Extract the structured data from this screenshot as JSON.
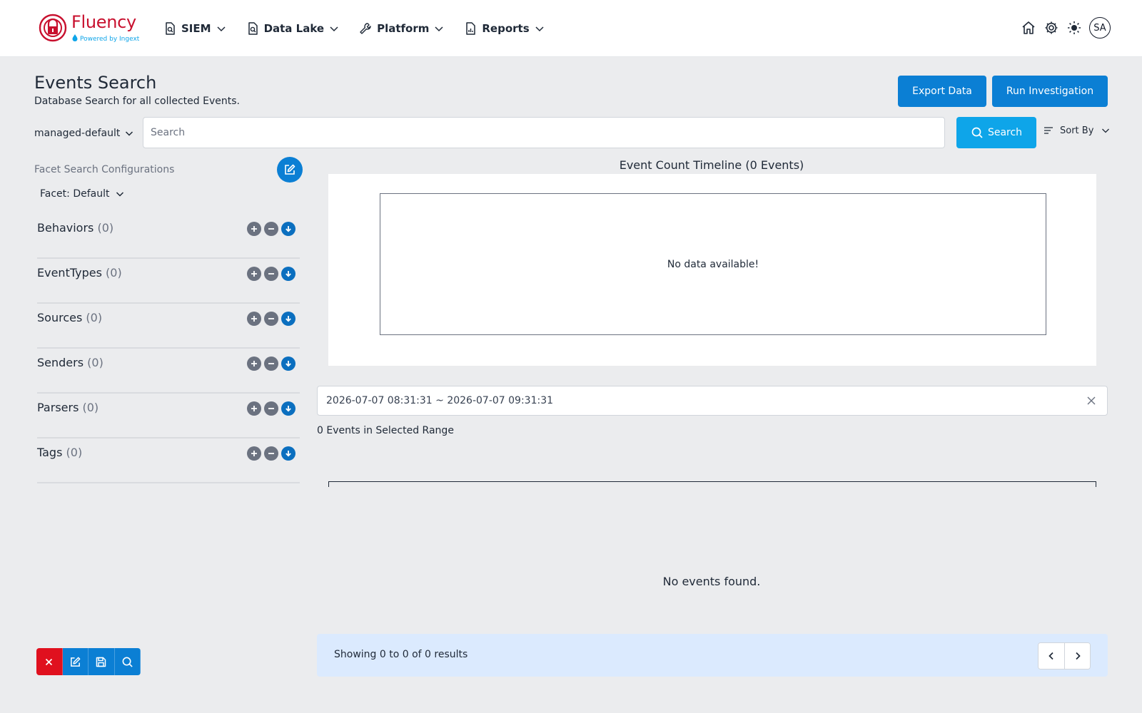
{
  "brand": {
    "name": "Fluency",
    "tagline": "Powered by Ingext",
    "logo_icon": "fluency-logo-icon",
    "color": "#c8102e"
  },
  "nav": {
    "items": [
      {
        "label": "SIEM",
        "icon": "document-search-icon"
      },
      {
        "label": "Data Lake",
        "icon": "document-search-icon"
      },
      {
        "label": "Platform",
        "icon": "wrench-icon"
      },
      {
        "label": "Reports",
        "icon": "document-chart-icon"
      }
    ],
    "right_icons": [
      "home-icon",
      "gear-icon",
      "sun-icon"
    ],
    "avatar": "SA"
  },
  "header": {
    "title": "Events Search",
    "subtitle": "Database Search for all collected Events.",
    "export_label": "Export Data",
    "investigate_label": "Run Investigation"
  },
  "search": {
    "namespace": "managed-default",
    "placeholder": "Search",
    "value": "",
    "button_label": "Search",
    "sort_label": "Sort By"
  },
  "facets": {
    "config_label": "Facet Search Configurations",
    "selected": "Facet: Default",
    "items": [
      {
        "name": "Behaviors",
        "count": "(0)"
      },
      {
        "name": "EventTypes",
        "count": "(0)"
      },
      {
        "name": "Sources",
        "count": "(0)"
      },
      {
        "name": "Senders",
        "count": "(0)"
      },
      {
        "name": "Parsers",
        "count": "(0)"
      },
      {
        "name": "Tags",
        "count": "(0)"
      }
    ]
  },
  "timeline": {
    "title": "Event Count Timeline (0 Events)",
    "empty_message": "No data available!"
  },
  "range": {
    "value": "2026-07-07 08:31:31 ~ 2026-07-07 09:31:31"
  },
  "results": {
    "count_text": "0 Events in Selected Range",
    "empty_message": "No events found.",
    "pager_text": "Showing 0 to 0 of 0 results"
  },
  "colors": {
    "primary": "#0b7fd4",
    "search": "#0ea5e9",
    "danger": "#e0101e",
    "pager_bg": "#dbeafe"
  }
}
